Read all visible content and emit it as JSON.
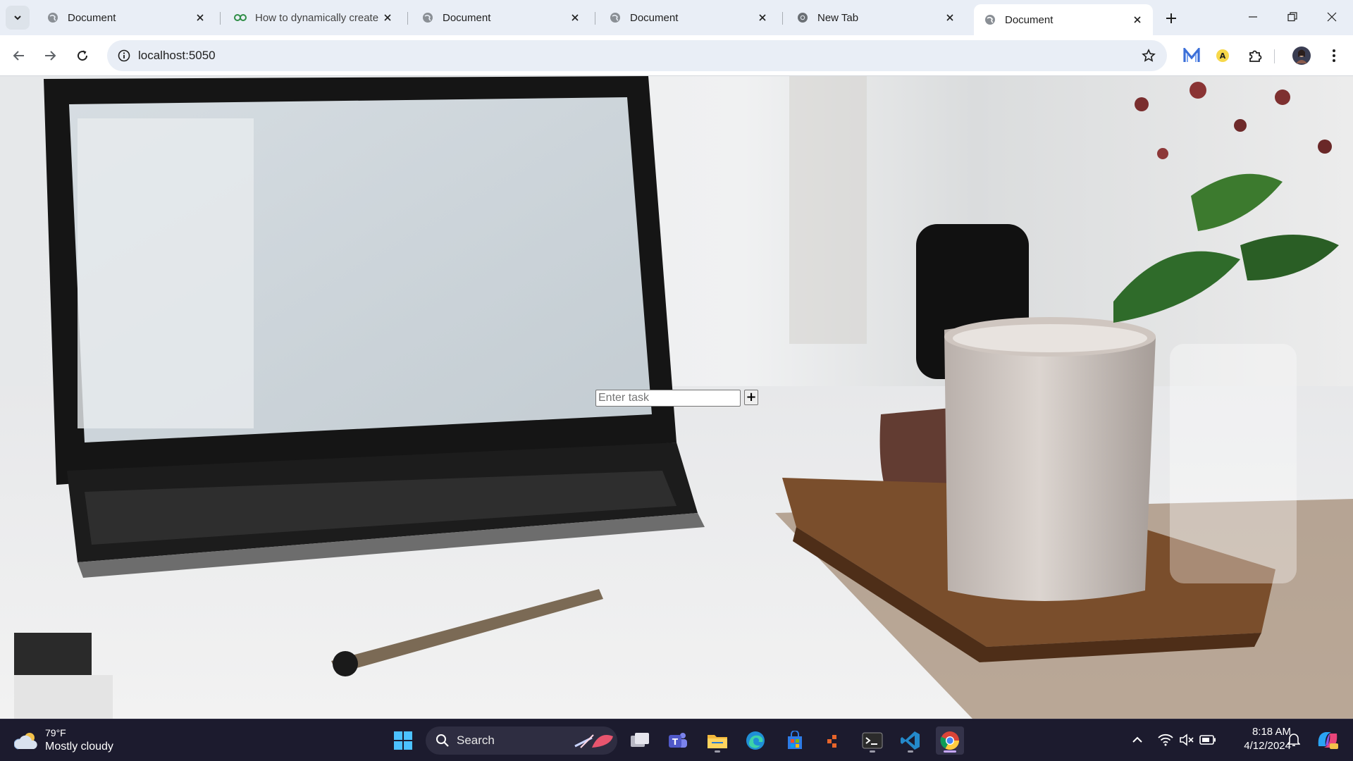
{
  "browser": {
    "tabs": [
      {
        "title": "Document",
        "favicon": "globe-icon",
        "active": false
      },
      {
        "title": "How to dynamically create",
        "favicon": "geeksforgeeks-icon",
        "active": false
      },
      {
        "title": "Document",
        "favicon": "globe-icon",
        "active": false
      },
      {
        "title": "Document",
        "favicon": "globe-icon",
        "active": false
      },
      {
        "title": "New Tab",
        "favicon": "chrome-icon",
        "active": false
      },
      {
        "title": "Document",
        "favicon": "globe-icon",
        "active": true
      }
    ],
    "address": {
      "url": "localhost:5050"
    },
    "extensions": [
      "extension-m-icon",
      "extension-a-icon",
      "puzzle-icon",
      "avatar"
    ],
    "colors": {
      "tabstrip": "#e9eef6",
      "active_tab": "#ffffff",
      "omnibox": "#e9eef6"
    }
  },
  "page": {
    "background": "photo of laptop, coffee mug, pen and flowers on a desk",
    "task_input": {
      "placeholder": "Enter task",
      "value": ""
    },
    "add_button": {
      "label": "+"
    }
  },
  "taskbar": {
    "weather": {
      "temp": "79°F",
      "desc": "Mostly cloudy"
    },
    "search": {
      "label": "Search"
    },
    "apps": [
      "task-view-icon",
      "teams-icon",
      "file-explorer-icon",
      "edge-icon",
      "store-icon",
      "app-icon",
      "terminal-icon",
      "vscode-icon",
      "chrome-icon"
    ],
    "clock": {
      "time": "8:18 AM",
      "date": "4/12/2024"
    },
    "colors": {
      "background": "#1c1b2e",
      "accent": "#c7a7ff"
    }
  }
}
